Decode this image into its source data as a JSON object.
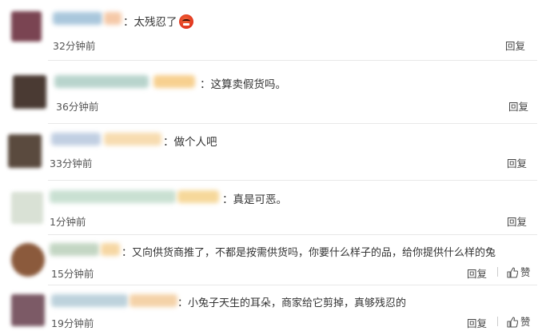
{
  "comments": [
    {
      "text": "：太残忍了",
      "time": "32分钟前",
      "reply": "回复",
      "emoji": "angry-face-emoji",
      "avatar_color": "#7a4452",
      "name_color": "#a9c7dc",
      "badge_color": "#f5c9a8"
    },
    {
      "text": "：这算卖假货吗。",
      "time": "36分钟前",
      "reply": "回复",
      "avatar_color": "#4a3a33",
      "name_color": "#b8d4cc",
      "badge_color": "#f7d08f"
    },
    {
      "text": "：做个人吧",
      "time": "33分钟前",
      "reply": "回复",
      "avatar_color": "#5a4a3e",
      "name_color": "#c1cfe2",
      "badge_color": "#f7dcb0"
    },
    {
      "text": "：真是可恶。",
      "time": "1分钟前",
      "reply": "回复",
      "avatar_color": "#d9e1d5",
      "name_color": "#c9e0d2",
      "badge_color": "#f6d89a"
    },
    {
      "text": "：又向供货商推了，不都是按需供货吗，你要什么样子的品，给你提供什么样的兔",
      "time": "15分钟前",
      "reply": "回复",
      "like": "赞",
      "avatar_color": "#8b5a3c",
      "name_color": "#c3d6c3",
      "badge_color": "#f6d7a3"
    },
    {
      "text": "：小兔子天生的耳朵，商家给它剪掉，真够残忍的",
      "time": "19分钟前",
      "reply": "回复",
      "like": "赞",
      "avatar_color": "#7c5a66",
      "name_color": "#bdd2dc",
      "badge_color": "#f4d2a8"
    }
  ]
}
